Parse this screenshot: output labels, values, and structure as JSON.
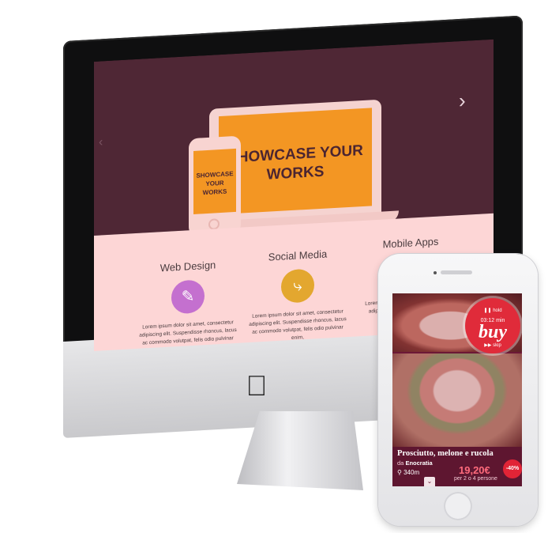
{
  "website": {
    "hero_title": "SHOWCASE YOUR WORKS",
    "phone_hero_title": "SHOWCASE YOUR WORKS",
    "slider_next_icon": "chevron-right-icon",
    "slider_prev_icon": "chevron-left-icon",
    "features": [
      {
        "title": "Web Design",
        "icon": "brush-icon",
        "color": "#c470cf",
        "text": "Lorem ipsum dolor sit amet, consectetur adipiscing elit. Suspendisse rhoncus, lacus ac commodo volutpat, felis odio pulvinar enim,"
      },
      {
        "title": "Social Media",
        "icon": "share-icon",
        "color": "#e3a72f",
        "text": "Lorem ipsum dolor sit amet, consectetur adipiscing elit. Suspendisse rhoncus, lacus ac commodo volutpat, felis odio pulvinar enim,"
      },
      {
        "title": "Mobile Apps",
        "icon": "mobile-icon",
        "color": "#e3a72f",
        "text": "Lorem ipsum dolor sit amet, consectetur adipiscing elit. Suspendisse rhoncus,"
      }
    ]
  },
  "app": {
    "buy_badge": {
      "hold": "hold",
      "time": "03:12 min",
      "buy": "buy",
      "skip": "skip"
    },
    "deal": {
      "title": "Prosciutto, melone e rucola",
      "vendor_prefix": "da",
      "vendor": "Enocratia",
      "distance": "340m",
      "price": "19,20€",
      "per_persons": "per 2 o 4 persone",
      "discount": "-40%"
    }
  },
  "colors": {
    "hero_bg": "#4f2735",
    "feature_bg": "#fdd6d6",
    "accent_orange": "#f39623",
    "app_bg": "#5e1630",
    "buy_red": "#e02b3a"
  }
}
